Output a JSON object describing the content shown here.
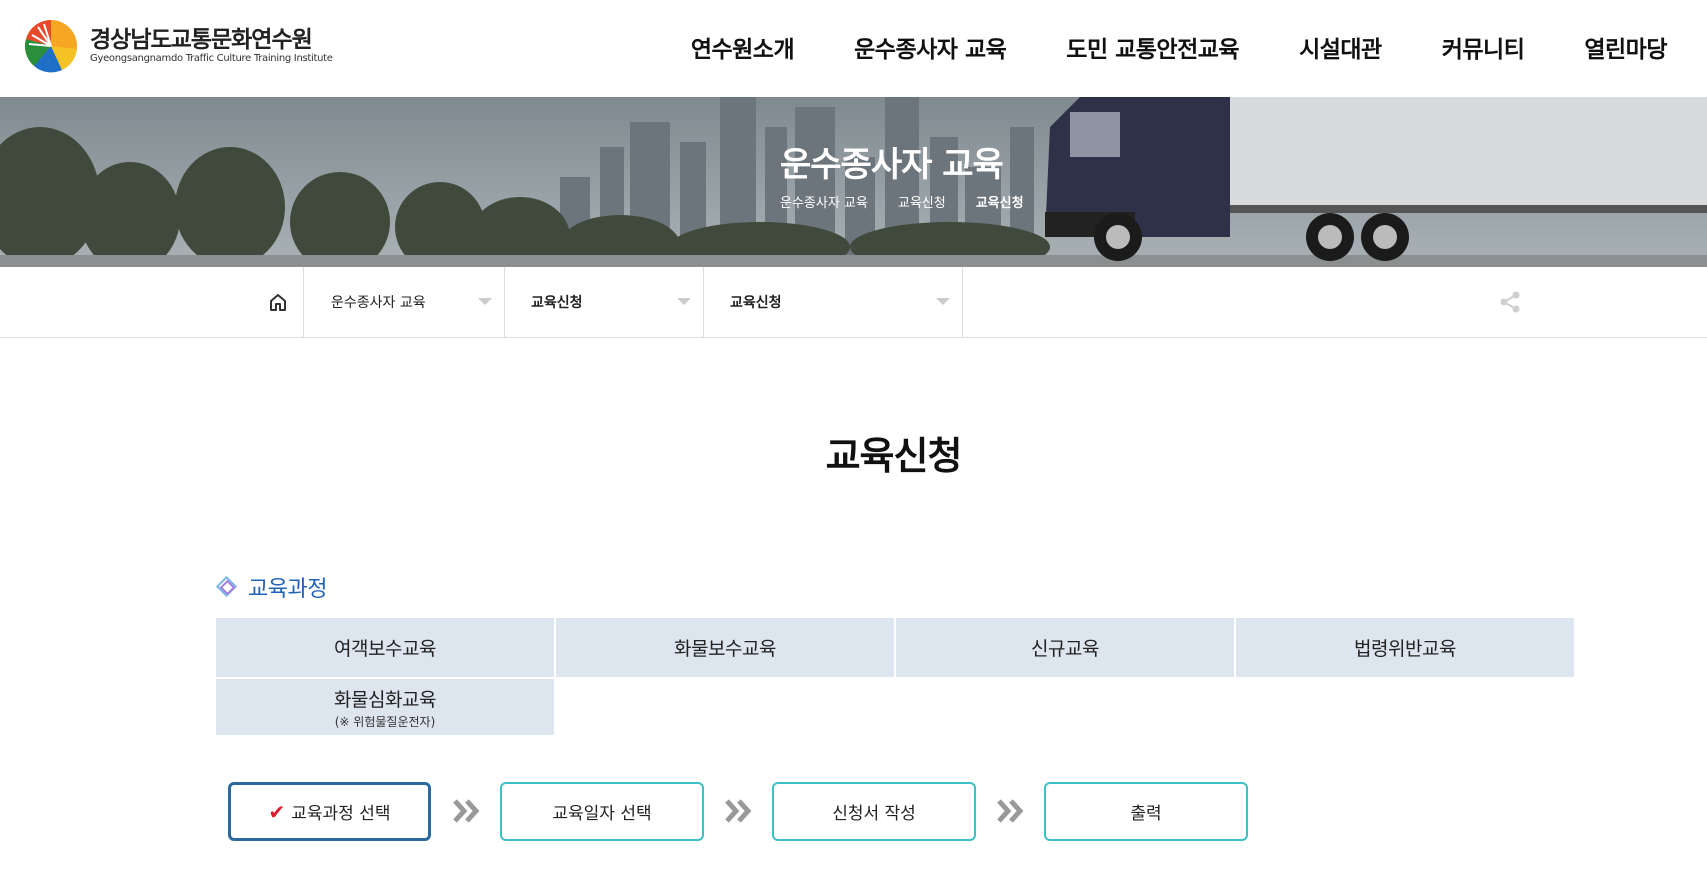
{
  "header": {
    "logo_ko": "경상남도교통문화연수원",
    "logo_en": "Gyeongsangnamdo Traffic Culture Training Institute",
    "nav": [
      {
        "label": "연수원소개"
      },
      {
        "label": "운수종사자 교육"
      },
      {
        "label": "도민 교통안전교육"
      },
      {
        "label": "시설대관"
      },
      {
        "label": "커뮤니티"
      },
      {
        "label": "열린마당"
      }
    ]
  },
  "banner": {
    "title": "운수종사자 교육",
    "crumbs": [
      "운수종사자 교육",
      "교육신청",
      "교육신청"
    ]
  },
  "location": {
    "selects": [
      "운수종사자 교육",
      "교육신청",
      "교육신청"
    ]
  },
  "page": {
    "title": "교육신청",
    "section_title": "교육과정"
  },
  "courses": [
    {
      "label": "여객보수교육"
    },
    {
      "label": "화물보수교육"
    },
    {
      "label": "신규교육"
    },
    {
      "label": "법령위반교육"
    },
    {
      "label": "화물심화교육",
      "sub": "(※ 위험물질운전자)"
    }
  ],
  "steps": [
    {
      "label": "교육과정 선택",
      "active": true
    },
    {
      "label": "교육일자 선택"
    },
    {
      "label": "신청서 작성"
    },
    {
      "label": "출력"
    }
  ],
  "colors": {
    "accent_blue": "#1f63b9",
    "step_border": "#3cc1c8",
    "step_active_border": "#2b6aa0",
    "course_bg": "#dde5ef",
    "check_red": "#e0162b"
  },
  "icons": {
    "home": "home-icon",
    "share": "share-icon",
    "section": "diamond-icon",
    "check": "check-icon",
    "step_arrow": "double-chevron-right-icon"
  }
}
